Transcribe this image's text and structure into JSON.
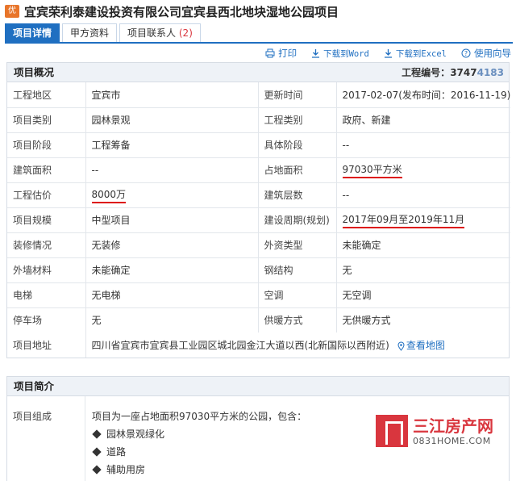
{
  "header": {
    "badge": "优",
    "title": "宜宾荣利泰建设投资有限公司宜宾县西北地块湿地公园项目"
  },
  "tabs": [
    {
      "label": "项目详情",
      "count": ""
    },
    {
      "label": "甲方资料",
      "count": ""
    },
    {
      "label": "项目联系人",
      "count": "(2)"
    }
  ],
  "toolbar": {
    "print": "打印",
    "word": "下载到Word",
    "excel": "下载到Excel",
    "guide": "使用向导"
  },
  "overview": {
    "heading": "项目概况",
    "project_no_label": "工程编号：",
    "project_no_value": "3747",
    "project_no_obscured": "4183",
    "rows": [
      [
        "工程地区",
        "宜宾市",
        "更新时间",
        "2017-02-07(发布时间：2016-11-19)"
      ],
      [
        "项目类别",
        "园林景观",
        "工程类别",
        "政府、新建"
      ],
      [
        "项目阶段",
        "工程筹备",
        "具体阶段",
        "--"
      ],
      [
        "建筑面积",
        "--",
        "占地面积",
        "97030平方米"
      ],
      [
        "工程估价",
        "8000万",
        "建筑层数",
        "--"
      ],
      [
        "项目规模",
        "中型项目",
        "建设周期(规划)",
        "2017年09月至2019年11月"
      ],
      [
        "装修情况",
        "无装修",
        "外资类型",
        "未能确定"
      ],
      [
        "外墙材料",
        "未能确定",
        "钢结构",
        "无"
      ],
      [
        "电梯",
        "无电梯",
        "空调",
        "无空调"
      ],
      [
        "停车场",
        "无",
        "供暖方式",
        "无供暖方式"
      ]
    ],
    "address_label": "项目地址",
    "address_value": "四川省宜宾市宜宾县工业园区城北园金江大道以西(北新国际以西附近)",
    "map_link": "查看地图"
  },
  "intro": {
    "heading": "项目简介",
    "label": "项目组成",
    "summary": "项目为一座占地面积97030平方米的公园，包含：",
    "items": [
      "园林景观绿化",
      "道路",
      "辅助用房"
    ]
  },
  "watermark": {
    "name": "三江房产网",
    "url": "0831HOME.COM"
  },
  "colors": {
    "accent": "#1f6fc1",
    "badge": "#e8752a",
    "underline": "#dd1111",
    "watermark": "#d9363e"
  }
}
